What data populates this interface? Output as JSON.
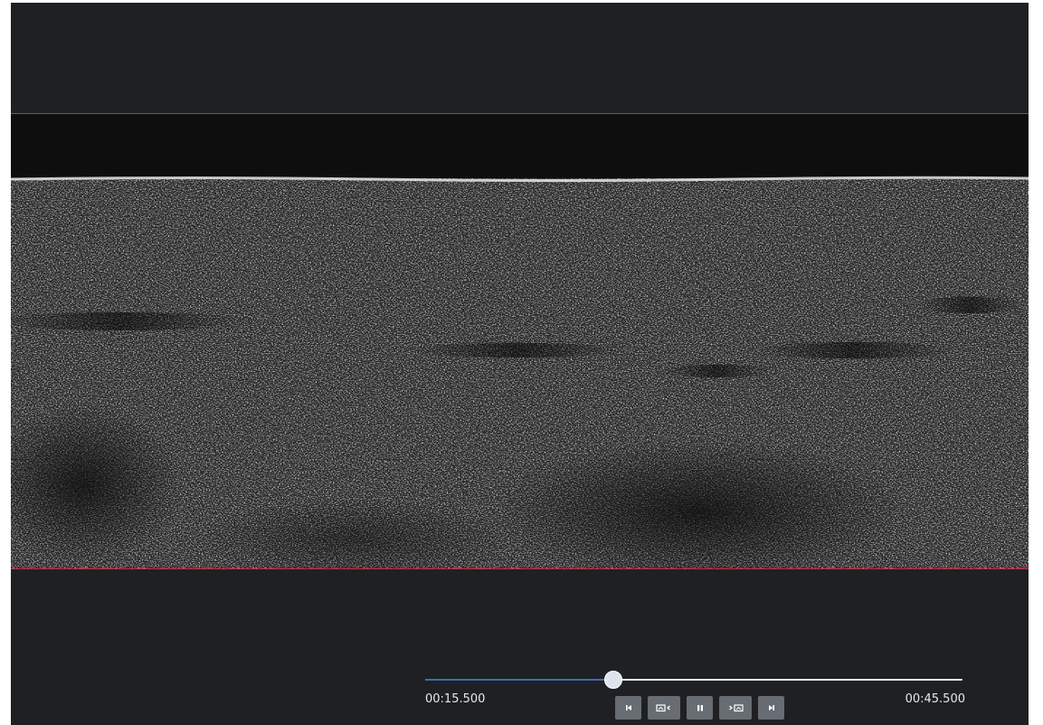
{
  "player": {
    "current_time": "00:15.500",
    "total_time": "00:45.500",
    "progress_fraction": 0.35
  },
  "controls": {
    "buttons": [
      {
        "name": "skip-to-start-button",
        "icon": "skip-back-icon"
      },
      {
        "name": "previous-frame-button",
        "icon": "frame-back-icon"
      },
      {
        "name": "pause-button",
        "icon": "pause-icon"
      },
      {
        "name": "next-frame-button",
        "icon": "frame-forward-icon"
      },
      {
        "name": "skip-to-end-button",
        "icon": "skip-forward-icon"
      }
    ]
  },
  "colors": {
    "background": "#1e2023",
    "roi_line": "#e0223d",
    "progress": "#3b6db3",
    "button": "#686c73"
  }
}
